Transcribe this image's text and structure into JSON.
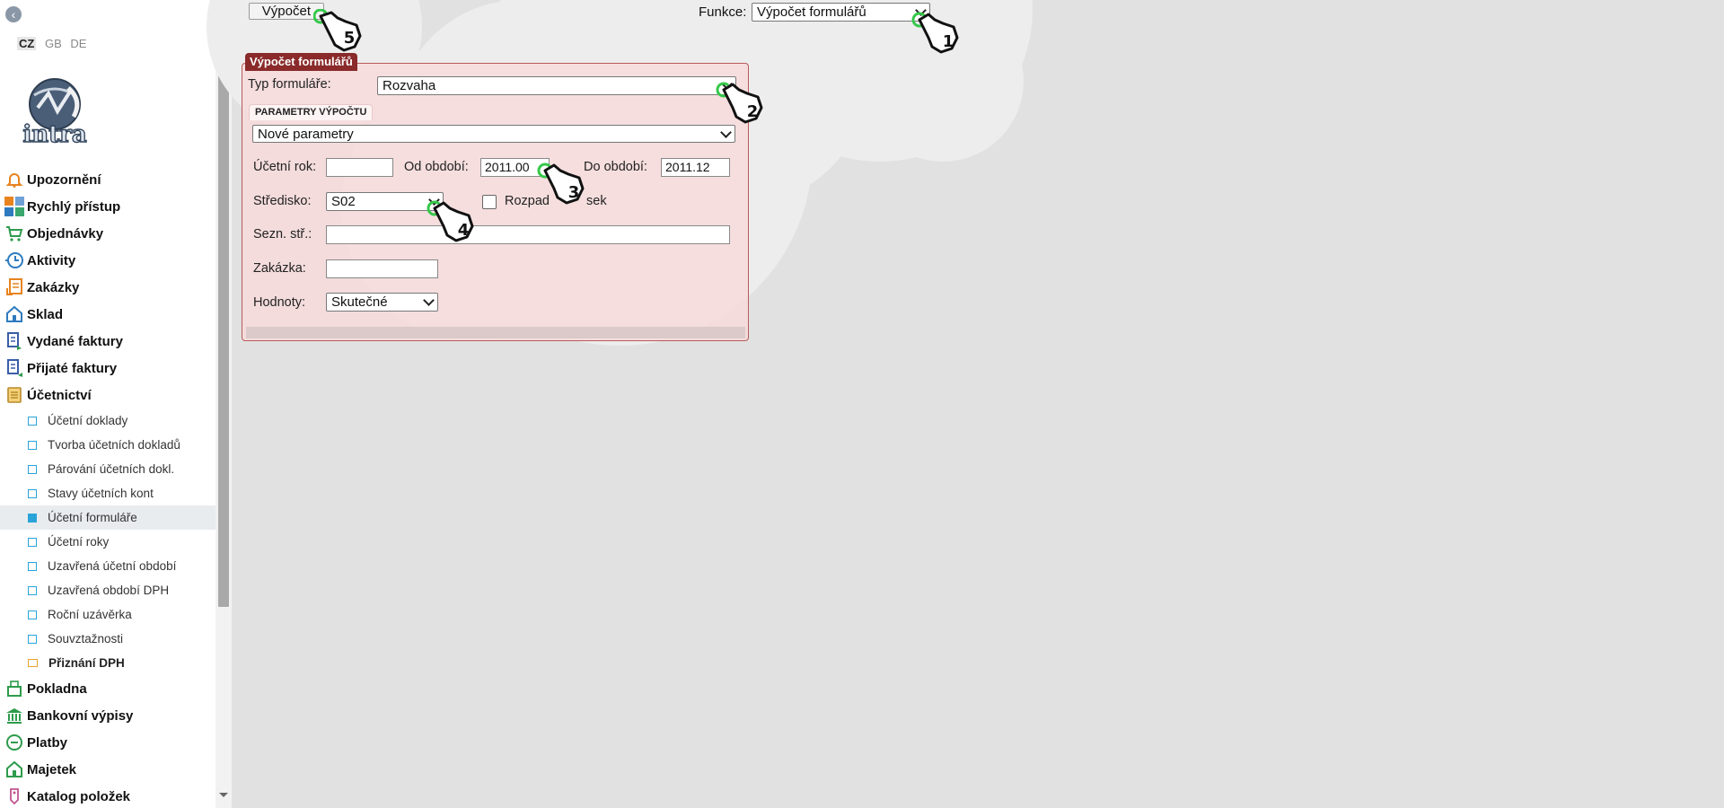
{
  "sidebar": {
    "languages": [
      {
        "code": "CZ",
        "active": true
      },
      {
        "code": "GB",
        "active": false
      },
      {
        "code": "DE",
        "active": false
      }
    ],
    "logo_text": "intra",
    "menu": [
      {
        "label": "Upozornění",
        "icon": "bell-icon",
        "level": "main"
      },
      {
        "label": "Rychlý přístup",
        "icon": "tiles-icon",
        "level": "main"
      },
      {
        "label": "Objednávky",
        "icon": "cart-icon",
        "level": "main"
      },
      {
        "label": "Aktivity",
        "icon": "clock-icon",
        "level": "main"
      },
      {
        "label": "Zakázky",
        "icon": "clipboard-icon",
        "level": "main"
      },
      {
        "label": "Sklad",
        "icon": "warehouse-icon",
        "level": "main"
      },
      {
        "label": "Vydané faktury",
        "icon": "invoice-out-icon",
        "level": "main"
      },
      {
        "label": "Přijaté faktury",
        "icon": "invoice-in-icon",
        "level": "main"
      },
      {
        "label": "Účetnictví",
        "icon": "ledger-icon",
        "level": "main"
      },
      {
        "label": "Účetní doklady",
        "level": "sub"
      },
      {
        "label": "Tvorba účetních dokladů",
        "level": "sub"
      },
      {
        "label": "Párování účetních dokl.",
        "level": "sub"
      },
      {
        "label": "Stavy účetních kont",
        "level": "sub"
      },
      {
        "label": "Účetní formuláře",
        "level": "sub",
        "active": true
      },
      {
        "label": "Účetní roky",
        "level": "sub"
      },
      {
        "label": "Uzavřená účetní období",
        "level": "sub"
      },
      {
        "label": "Uzavřená období DPH",
        "level": "sub"
      },
      {
        "label": "Roční uzávěrka",
        "level": "sub"
      },
      {
        "label": "Souvztažnosti",
        "level": "sub"
      },
      {
        "label": "Přiznání DPH",
        "level": "sub",
        "folder": true
      },
      {
        "label": "Pokladna",
        "icon": "cash-register-icon",
        "level": "main"
      },
      {
        "label": "Bankovní výpisy",
        "icon": "bank-icon",
        "level": "main"
      },
      {
        "label": "Platby",
        "icon": "coin-icon",
        "level": "main"
      },
      {
        "label": "Majetek",
        "icon": "building-icon",
        "level": "main"
      },
      {
        "label": "Katalog položek",
        "icon": "tag-icon",
        "level": "main"
      }
    ]
  },
  "toolbar": {
    "calc_button": "Výpočet",
    "funkce_label": "Funkce:",
    "funkce_value": "Výpočet formulářů"
  },
  "panel": {
    "title": "Výpočet formulářů",
    "form_type_label": "Typ formuláře:",
    "form_type_value": "Rozvaha",
    "tab_label": "PARAMETRY VÝPOČTU",
    "params_value": "Nové parametry",
    "year_label": "Účetní rok:",
    "year_value": "",
    "from_label": "Od období:",
    "from_value": "2011.00",
    "to_label": "Do období:",
    "to_value": "2011.12",
    "center_label": "Středisko:",
    "center_value": "S02",
    "split_label": "Rozpad",
    "split_label_tail": "sek",
    "center_list_label": "Sezn. stř.:",
    "center_list_value": "",
    "order_label": "Zakázka:",
    "order_value": "",
    "values_label": "Hodnoty:",
    "values_value": "Skutečné"
  },
  "callouts": [
    "1",
    "2",
    "3",
    "4",
    "5"
  ],
  "colors": {
    "panel_border": "#b85a5a",
    "panel_title_bg": "#8a2a2a",
    "submenu_marker": "#29a4d9",
    "callout_ring": "#35c84a"
  }
}
